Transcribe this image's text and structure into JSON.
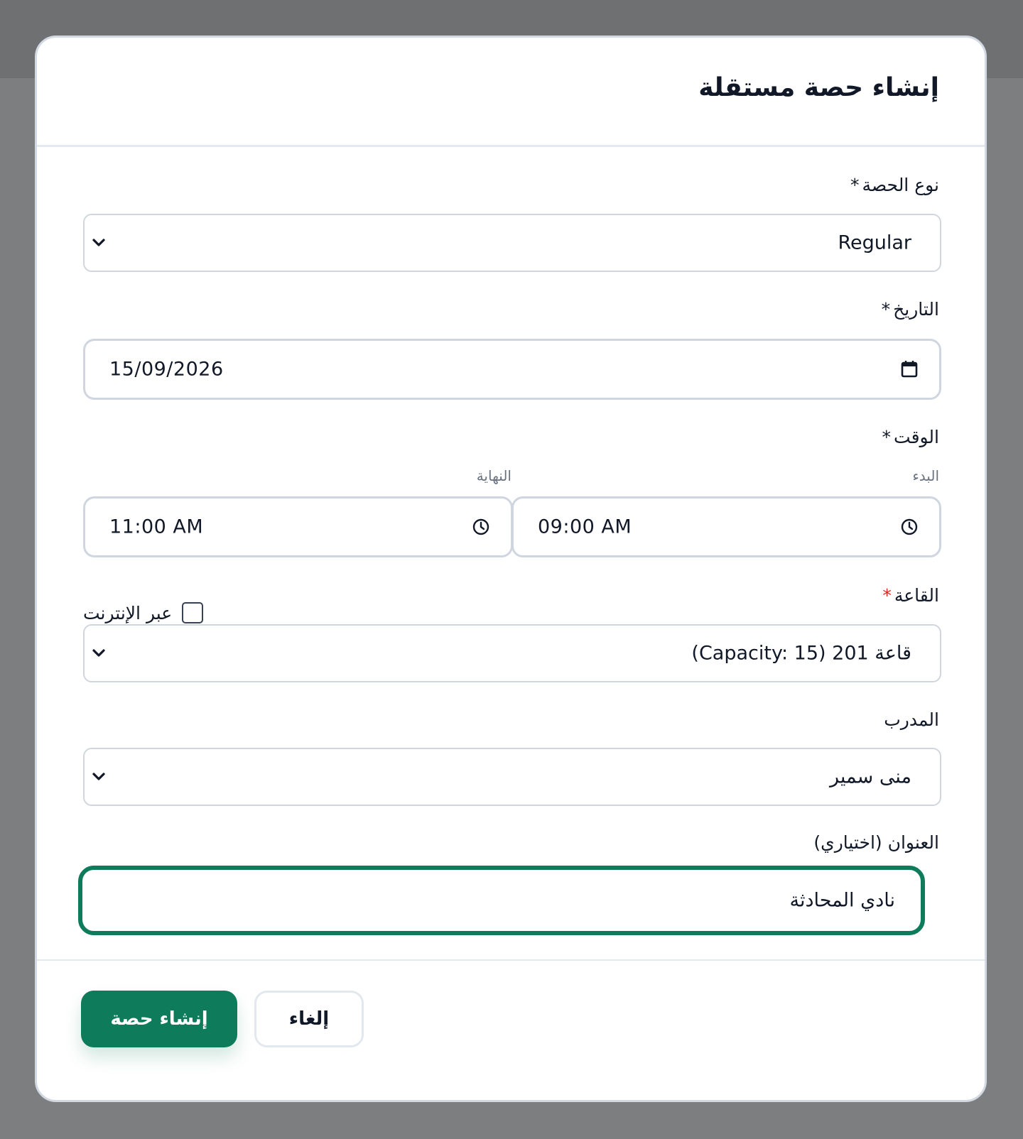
{
  "dialog": {
    "title": "إنشاء حصة مستقلة"
  },
  "session_type": {
    "label": "نوع الحصة",
    "required_mark": "*",
    "value": "Regular"
  },
  "date": {
    "label": "التاريخ",
    "required_mark": "*",
    "value": "15/09/2026",
    "icon": "calendar-icon"
  },
  "time": {
    "label": "الوقت",
    "required_mark": "*",
    "start_label": "البدء",
    "start_value": "09:00  AM",
    "end_label": "النهاية",
    "end_value": "11:00  AM",
    "icon": "clock-icon"
  },
  "room": {
    "label": "القاعة",
    "required_mark": "*",
    "required_color": "#e02424",
    "value": "قاعة 201 (Capacity: 15)",
    "online_label": "عبر الإنترنت",
    "online_checked": false
  },
  "trainer": {
    "label": "المدرب",
    "value": "منى سمير"
  },
  "session_title": {
    "label": "العنوان (اختياري)",
    "value": "نادي المحادثة"
  },
  "actions": {
    "create_label": "إنشاء حصة",
    "cancel_label": "إلغاء"
  },
  "colors": {
    "primary": "#0e7c5b",
    "overlay": "#7d7e80",
    "text": "#111827",
    "muted": "#6b7280",
    "border": "#d0d6de"
  }
}
